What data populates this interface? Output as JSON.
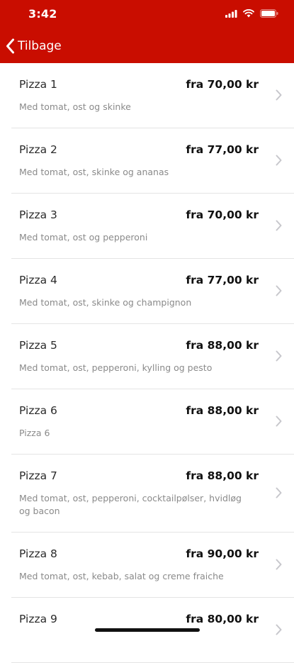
{
  "status_bar": {
    "time": "3:42",
    "icons": [
      "signal-icon",
      "wifi-icon",
      "battery-icon"
    ]
  },
  "nav": {
    "back_label": "Tilbage"
  },
  "theme": {
    "header_color": "#c90d00"
  },
  "items": [
    {
      "name": "Pizza 1",
      "price": "fra 70,00 kr",
      "desc": "Med tomat, ost og skinke"
    },
    {
      "name": "Pizza 2",
      "price": "fra 77,00 kr",
      "desc": "Med tomat, ost, skinke og ananas"
    },
    {
      "name": "Pizza 3",
      "price": "fra 70,00 kr",
      "desc": "Med tomat, ost og pepperoni"
    },
    {
      "name": "Pizza 4",
      "price": "fra 77,00 kr",
      "desc": "Med tomat, ost, skinke og champignon"
    },
    {
      "name": "Pizza 5",
      "price": "fra 88,00 kr",
      "desc": "Med tomat, ost, pepperoni, kylling og pesto"
    },
    {
      "name": "Pizza 6",
      "price": "fra 88,00 kr",
      "desc": "Pizza 6"
    },
    {
      "name": "Pizza 7",
      "price": "fra 88,00 kr",
      "desc": "Med tomat, ost, pepperoni, cocktailpølser, hvidløg og bacon"
    },
    {
      "name": "Pizza 8",
      "price": "fra 90,00 kr",
      "desc": "Med tomat, ost, kebab, salat og creme fraiche"
    },
    {
      "name": "Pizza 9",
      "price": "fra 80,00 kr",
      "desc": ""
    }
  ]
}
